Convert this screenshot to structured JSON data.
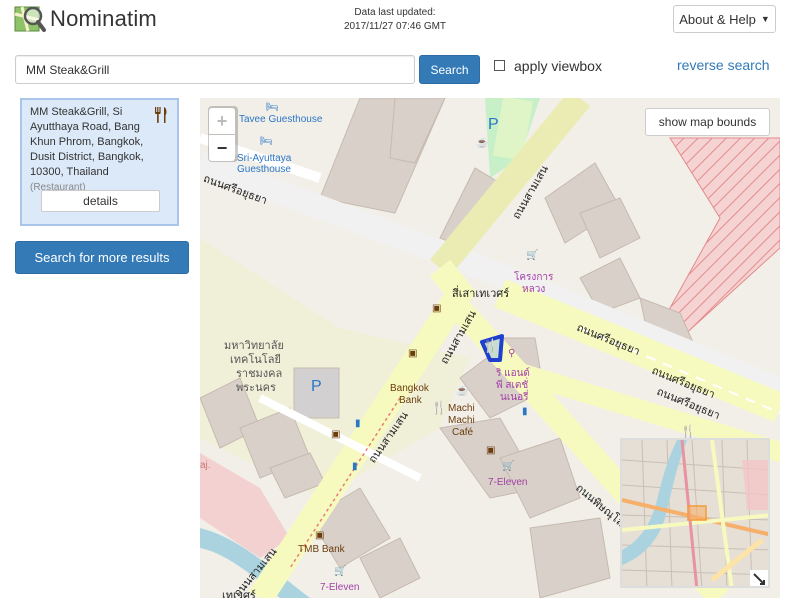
{
  "header": {
    "brand": "Nominatim",
    "data_updated_label": "Data last updated:",
    "data_updated_value": "2017/11/27 07:46 GMT",
    "about_label": "About & Help"
  },
  "search": {
    "query": "MM Steak&Grill",
    "button_label": "Search",
    "viewbox_label": "apply viewbox",
    "reverse_label": "reverse search"
  },
  "result": {
    "address": "MM Steak&Grill, Si Ayutthaya Road, Bang Khun Phrom, Bangkok, Dusit District, Bangkok, 10300, Thailand",
    "type": "(Restaurant)",
    "details_label": "details",
    "icon": "restaurant-icon"
  },
  "more_results_label": "Search for more results",
  "map": {
    "zoom_in": "+",
    "zoom_out": "−",
    "bounds_label": "show map bounds",
    "labels": {
      "tavee": "Tavee Guesthouse",
      "sri1": "Sri-Ayuttaya",
      "sri2": "Guesthouse",
      "road_si_ayutthaya_top": "ถนนศรีอยุธยา",
      "road_samsen_top": "ถนนสามเสน",
      "junction": "สี่เสาเทเวศร์",
      "road_samsen_mid": "ถนนสามเสน",
      "road_samsen_low": "ถนนสามเสน",
      "road_samsen_bottom": "ถนนสามเสน",
      "road_si_mid": "ถนนศรีอยุธยา",
      "road_si_r1": "ถนนศรีอยุธยา",
      "road_si_r2": "ถนนศรีอยุธยา",
      "road_phitsanulok": "ถนนพิษณุโลก",
      "univ1": "มหาวิทยาลัย",
      "univ2": "เทคโนโลยี",
      "univ3": "ราชมงคล",
      "univ4": "พระนคร",
      "bangkok_bank1": "Bangkok",
      "bangkok_bank2": "Bank",
      "machi1": "Machi",
      "machi2": "Machi",
      "machi3": "Café",
      "seven1": "7-Eleven",
      "seven2": "7-Eleven",
      "tmb": "TMB Bank",
      "krong1": "โครงการ",
      "krong2": "หลวง",
      "ri1": "ริ แอนด์",
      "ri2": "พี สเตชั่",
      "ri3": "นเนอรี่",
      "tewes": "เทเวศร์",
      "raj": "aj.",
      "parking": "P"
    }
  }
}
